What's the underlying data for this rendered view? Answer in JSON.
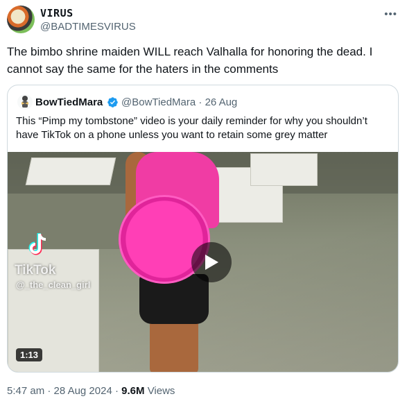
{
  "tweet": {
    "author": {
      "display_name": "VIRUS",
      "handle": "@BADTIMESVIRUS"
    },
    "text": "The bimbo shrine maiden WILL reach Valhalla for honoring the dead. I cannot say the same for the haters in the comments",
    "more_icon": "more-horizontal-icon",
    "meta": {
      "time": "5:47 am",
      "sep": "·",
      "date": "28 Aug 2024",
      "sep2": "·",
      "views_count": "9.6M",
      "views_label": "Views"
    }
  },
  "quote": {
    "author": {
      "display_name": "BowTiedMara",
      "handle": "@BowTiedMara",
      "sep": "·",
      "date": "26 Aug"
    },
    "verified_icon": "verified-badge-icon",
    "text": "This “Pimp my tombstone” video is your daily reminder for why you shouldn’t have TikTok on a phone unless you want to retain some grey matter",
    "media": {
      "watermark_brand": "TikTok",
      "watermark_user": "@_the_clean_girl",
      "duration": "1:13",
      "play_icon": "play-icon"
    }
  },
  "colors": {
    "text": "#0f1419",
    "secondary": "#536471",
    "verified": "#1d9bf0",
    "pink": "#f03ca4"
  }
}
